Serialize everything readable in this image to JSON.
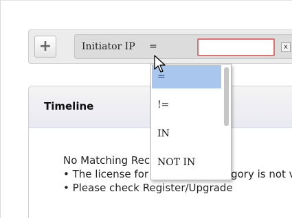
{
  "filter_bar": {
    "add_label": "+",
    "field_label": "Initiator IP",
    "operator": "=",
    "value": "",
    "remove_label": "x"
  },
  "operator_dropdown": {
    "options": [
      "=",
      "!=",
      "IN",
      "NOT IN"
    ],
    "selected_index": 0
  },
  "panel": {
    "title": "Timeline",
    "messages": [
      "No Matching Records Found",
      "• The license for this report category is not valid",
      "• Please check Register/Upgrade"
    ]
  },
  "colors": {
    "selected_option_bg": "#a9c7ee",
    "input_border_error": "#e07070"
  },
  "icons": {
    "add": "plus-icon",
    "remove": "close-icon",
    "cursor": "mouse-pointer-icon"
  }
}
